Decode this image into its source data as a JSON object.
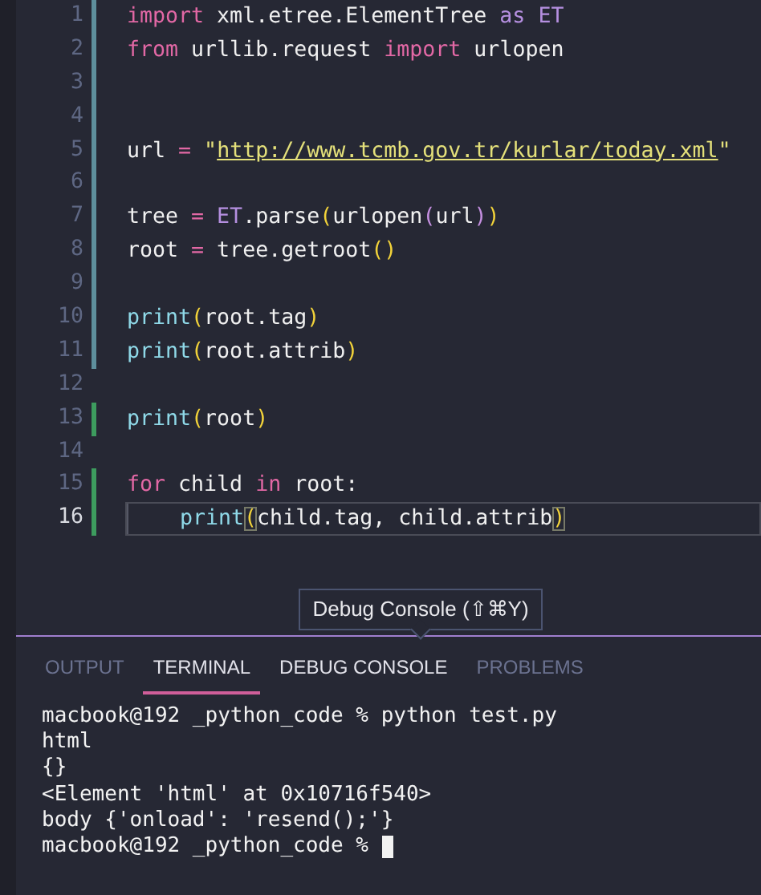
{
  "editor": {
    "lines": [
      {
        "number": "1",
        "modified": true,
        "added": false,
        "current": false,
        "indented": false,
        "tokens": [
          {
            "kind": "keyword",
            "text": "import"
          },
          {
            "kind": "plain",
            "text": " xml.etree.ElementTree "
          },
          {
            "kind": "keyword2",
            "text": "as"
          },
          {
            "kind": "name",
            "text": " ET"
          }
        ]
      },
      {
        "number": "2",
        "modified": true,
        "added": false,
        "current": false,
        "indented": false,
        "tokens": [
          {
            "kind": "keyword",
            "text": "from"
          },
          {
            "kind": "plain",
            "text": " urllib.request "
          },
          {
            "kind": "keyword",
            "text": "import"
          },
          {
            "kind": "plain",
            "text": " urlopen"
          }
        ]
      },
      {
        "number": "3",
        "modified": true,
        "added": false,
        "current": false,
        "indented": false
      },
      {
        "number": "4",
        "modified": true,
        "added": false,
        "current": false,
        "indented": false
      },
      {
        "number": "5",
        "modified": true,
        "added": false,
        "current": false,
        "indented": false,
        "tokens": [
          {
            "kind": "plain",
            "text": "url "
          },
          {
            "kind": "op",
            "text": "="
          },
          {
            "kind": "string",
            "text": " \""
          },
          {
            "kind": "link",
            "text": "http://www.tcmb.gov.tr/kurlar/today.xml"
          },
          {
            "kind": "string",
            "text": "\""
          }
        ]
      },
      {
        "number": "6",
        "modified": true,
        "added": false,
        "current": false,
        "indented": false
      },
      {
        "number": "7",
        "modified": true,
        "added": false,
        "current": false,
        "indented": false,
        "tokens": [
          {
            "kind": "plain",
            "text": "tree "
          },
          {
            "kind": "op",
            "text": "="
          },
          {
            "kind": "name",
            "text": " ET"
          },
          {
            "kind": "plain",
            "text": ".parse"
          },
          {
            "kind": "paren",
            "text": "("
          },
          {
            "kind": "plain",
            "text": "urlopen"
          },
          {
            "kind": "paren2",
            "text": "("
          },
          {
            "kind": "plain",
            "text": "url"
          },
          {
            "kind": "paren2",
            "text": ")"
          },
          {
            "kind": "paren",
            "text": ")"
          }
        ]
      },
      {
        "number": "8",
        "modified": true,
        "added": false,
        "current": false,
        "indented": false,
        "tokens": [
          {
            "kind": "plain",
            "text": "root "
          },
          {
            "kind": "op",
            "text": "="
          },
          {
            "kind": "plain",
            "text": " tree.getroot"
          },
          {
            "kind": "paren",
            "text": "()"
          }
        ]
      },
      {
        "number": "9",
        "modified": true,
        "added": false,
        "current": false,
        "indented": false
      },
      {
        "number": "10",
        "modified": true,
        "added": false,
        "current": false,
        "indented": false,
        "tokens": [
          {
            "kind": "func",
            "text": "print"
          },
          {
            "kind": "paren",
            "text": "("
          },
          {
            "kind": "plain",
            "text": "root.tag"
          },
          {
            "kind": "paren",
            "text": ")"
          }
        ]
      },
      {
        "number": "11",
        "modified": true,
        "added": false,
        "current": false,
        "indented": false,
        "tokens": [
          {
            "kind": "func",
            "text": "print"
          },
          {
            "kind": "paren",
            "text": "("
          },
          {
            "kind": "plain",
            "text": "root.attrib"
          },
          {
            "kind": "paren",
            "text": ")"
          }
        ]
      },
      {
        "number": "12",
        "modified": false,
        "added": false,
        "current": false,
        "indented": false
      },
      {
        "number": "13",
        "modified": false,
        "added": true,
        "current": false,
        "indented": false,
        "tokens": [
          {
            "kind": "func",
            "text": "print"
          },
          {
            "kind": "paren",
            "text": "("
          },
          {
            "kind": "plain",
            "text": "root"
          },
          {
            "kind": "paren",
            "text": ")"
          }
        ]
      },
      {
        "number": "14",
        "modified": false,
        "added": false,
        "current": false,
        "indented": false
      },
      {
        "number": "15",
        "modified": false,
        "added": true,
        "current": false,
        "indented": false,
        "tokens": [
          {
            "kind": "keyword",
            "text": "for"
          },
          {
            "kind": "plain",
            "text": " child "
          },
          {
            "kind": "keyword",
            "text": "in"
          },
          {
            "kind": "plain",
            "text": " root:"
          }
        ]
      },
      {
        "number": "16",
        "modified": false,
        "added": true,
        "current": true,
        "indented": true,
        "tokens": [
          {
            "kind": "func",
            "text": "print"
          },
          {
            "kind": "match",
            "text": "("
          },
          {
            "kind": "plain",
            "text": "child.tag, child.attrib"
          },
          {
            "kind": "match",
            "text": ")"
          }
        ]
      }
    ]
  },
  "tooltip": {
    "text": "Debug Console (⇧⌘Y)"
  },
  "panel": {
    "tabs": [
      {
        "label": "OUTPUT",
        "selected": false,
        "hovered": false
      },
      {
        "label": "TERMINAL",
        "selected": true,
        "hovered": false
      },
      {
        "label": "DEBUG CONSOLE",
        "selected": false,
        "hovered": true
      },
      {
        "label": "PROBLEMS",
        "selected": false,
        "hovered": false
      }
    ],
    "terminal": [
      {
        "text": "macbook@192 _python_code % python test.py",
        "cursor": false
      },
      {
        "text": "html",
        "cursor": false
      },
      {
        "text": "{}",
        "cursor": false
      },
      {
        "text": "<Element 'html' at 0x10716f540>",
        "cursor": false
      },
      {
        "text": "body {'onload': 'resend();'}",
        "cursor": false
      },
      {
        "text": "macbook@192 _python_code %",
        "cursor": true
      }
    ]
  }
}
